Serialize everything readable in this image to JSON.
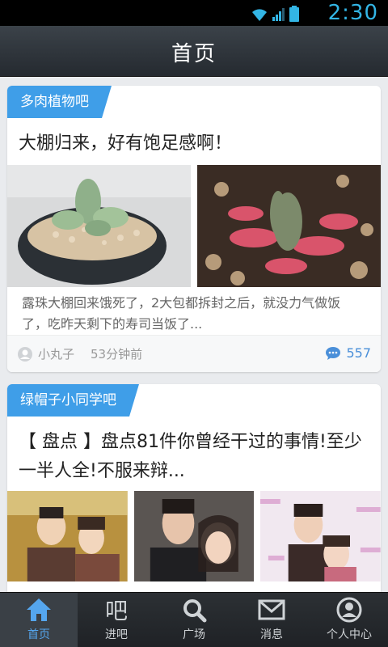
{
  "status_bar": {
    "time": "2:30"
  },
  "header": {
    "title": "首页"
  },
  "posts": [
    {
      "forum": "多肉植物吧",
      "title": "大棚归来，好有饱足感啊！",
      "excerpt": "露珠大棚回来饿死了，2大包都拆封之后，就没力气做饭了，吃昨天剩下的寿司当饭了...",
      "author": "小丸子",
      "time": "53分钟前",
      "comments": "557"
    },
    {
      "forum": "绿帽子小同学吧",
      "title": "【 盘点 】盘点81件你曾经干过的事情!至少一半人全!不服来辩..."
    }
  ],
  "nav": {
    "items": [
      {
        "label": "首页",
        "icon": "home-icon"
      },
      {
        "label": "进吧",
        "icon": "ba-icon"
      },
      {
        "label": "广场",
        "icon": "search-icon"
      },
      {
        "label": "消息",
        "icon": "mail-icon"
      },
      {
        "label": "个人中心",
        "icon": "user-icon"
      }
    ],
    "active_index": 0
  },
  "colors": {
    "accent": "#3f9ee8",
    "status": "#33b5e5",
    "nav_active": "#55a6ee"
  }
}
